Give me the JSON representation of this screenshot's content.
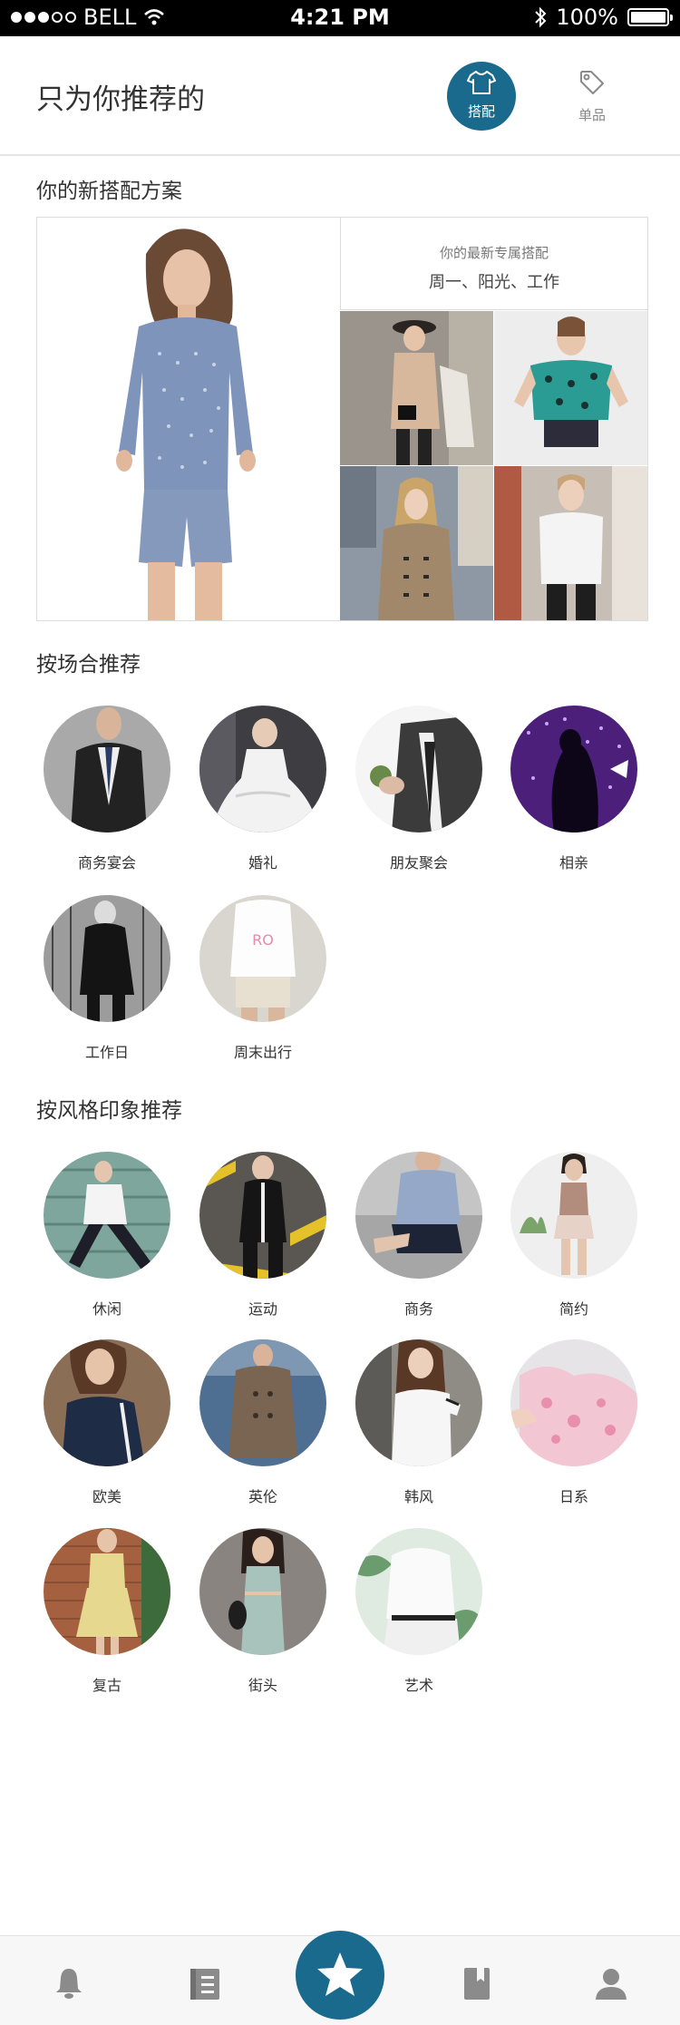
{
  "status_bar": {
    "carrier": "BELL",
    "time": "4:21 PM",
    "battery": "100%"
  },
  "header": {
    "title": "只为你推荐的",
    "tabs": [
      {
        "label": "搭配",
        "icon": "shirt-icon",
        "active": true
      },
      {
        "label": "单品",
        "icon": "tag-icon",
        "active": false
      }
    ]
  },
  "new_outfit": {
    "section_title": "你的新搭配方案",
    "subtitle": "你的最新专属搭配",
    "tags": "周一、阳光、工作"
  },
  "occasions": {
    "section_title": "按场合推荐",
    "items": [
      {
        "label": "商务宴会"
      },
      {
        "label": "婚礼"
      },
      {
        "label": "朋友聚会"
      },
      {
        "label": "相亲"
      },
      {
        "label": "工作日"
      },
      {
        "label": "周末出行"
      }
    ]
  },
  "styles": {
    "section_title": "按风格印象推荐",
    "items": [
      {
        "label": "休闲"
      },
      {
        "label": "运动"
      },
      {
        "label": "商务"
      },
      {
        "label": "简约"
      },
      {
        "label": "欧美"
      },
      {
        "label": "英伦"
      },
      {
        "label": "韩风"
      },
      {
        "label": "日系"
      },
      {
        "label": "复古"
      },
      {
        "label": "街头"
      },
      {
        "label": "艺术"
      }
    ]
  },
  "bottom_nav": [
    {
      "icon": "bell-icon"
    },
    {
      "icon": "notebook-icon"
    },
    {
      "icon": "star-icon"
    },
    {
      "icon": "bookmark-icon"
    },
    {
      "icon": "user-icon"
    }
  ],
  "colors": {
    "accent": "#1a6a8e"
  }
}
